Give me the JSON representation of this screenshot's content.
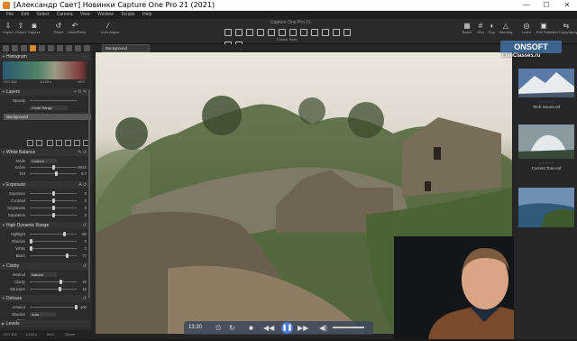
{
  "titlebar": {
    "title": "[Александр Свет] Новинки Capture One Pro 21 (2021)",
    "minimize": "—",
    "maximize": "☐",
    "close": "✕"
  },
  "menubar": {
    "items": [
      "File",
      "Edit",
      "Select",
      "Camera",
      "View",
      "Window",
      "Scripts",
      "Help"
    ]
  },
  "document_title": "Capture One Pro 21",
  "toolbar": {
    "import": "Import",
    "export": "Export",
    "capture": "Capture",
    "reset": "Reset",
    "undo_redo": "Undo/Redo",
    "auto_adjust": "Auto Adjust",
    "cursor_tools": "Cursor Tools",
    "batch": "Batch",
    "grid": "Grid",
    "exp": "Exp.",
    "warning": "Warning",
    "learn": "Learn",
    "edit_selected": "Edit Selected",
    "copy_apply": "Copy/Apply"
  },
  "subbar": {
    "layer_select": "Background"
  },
  "watermark": {
    "brand": "ONSOFT",
    "site": "LiveClasses.ru"
  },
  "histogram": {
    "title": "Histogram",
    "iso": "ISO 100",
    "shutter": "1/160 s",
    "aperture": "f/8.0"
  },
  "layers": {
    "title": "Layers",
    "opacity_label": "Opacity",
    "circle_range": "Circle Range",
    "background": "Background"
  },
  "white_balance": {
    "title": "White Balance",
    "mode_label": "Mode",
    "mode_value": "Custom",
    "kelvin_label": "Kelvin",
    "kelvin_value": "6910",
    "tint_label": "Tint",
    "tint_value": "6.7"
  },
  "exposure": {
    "title": "Exposure",
    "rows": [
      {
        "label": "Exposure",
        "value": "0"
      },
      {
        "label": "Contrast",
        "value": "0"
      },
      {
        "label": "Brightness",
        "value": "0"
      },
      {
        "label": "Saturation",
        "value": "0"
      }
    ]
  },
  "hdr": {
    "title": "High Dynamic Range",
    "rows": [
      {
        "label": "Highlight",
        "value": "-60"
      },
      {
        "label": "Shadow",
        "value": "0"
      },
      {
        "label": "White",
        "value": "0"
      },
      {
        "label": "Black",
        "value": "77"
      }
    ]
  },
  "clarity": {
    "title": "Clarity",
    "method_label": "Method",
    "method_value": "Natural",
    "clarity_label": "Clarity",
    "clarity_value": "20",
    "structure_label": "Structure",
    "structure_value": "18"
  },
  "dehaze": {
    "title": "Dehaze",
    "amount_label": "Amount",
    "amount_value": "100",
    "shadow_label": "Shadow Tone",
    "shadow_value": "Auto"
  },
  "levels": {
    "title": "Levels"
  },
  "bottom_strip": [
    "ISO 100",
    "1/160 s",
    "f/8.0",
    "24mm"
  ],
  "player": {
    "timecode": "13:20"
  },
  "browser": {
    "thumbs": [
      {
        "name": "Tech Issues.raf"
      },
      {
        "name": "Current Tone.raf"
      }
    ]
  },
  "colors": {
    "accent": "#4c7ad8",
    "panel": "#2b2b2b"
  }
}
